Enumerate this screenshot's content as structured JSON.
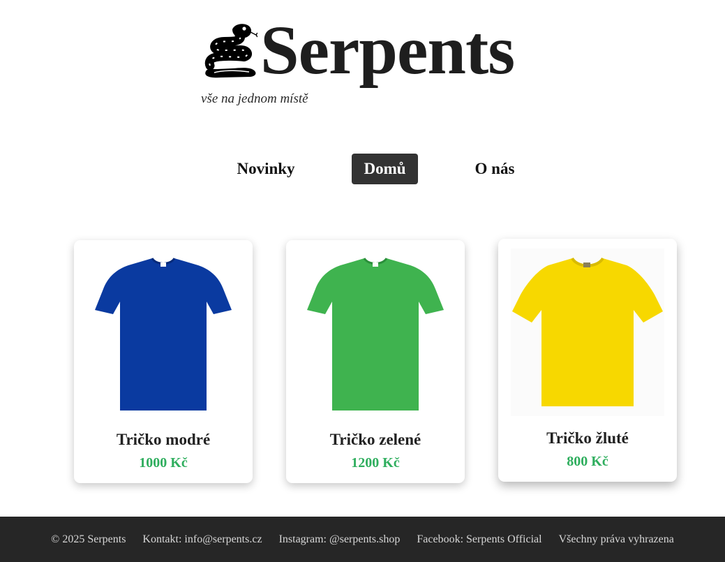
{
  "header": {
    "brand": "Serpents",
    "tagline": "vše na jednom místě",
    "logo_icon": "snake-icon"
  },
  "nav": {
    "items": [
      {
        "label": "Novinky",
        "active": false
      },
      {
        "label": "Domů",
        "active": true
      },
      {
        "label": "O nás",
        "active": false
      }
    ],
    "active_color": "#333333"
  },
  "products": [
    {
      "name": "Tričko modré",
      "price": "1000 Kč",
      "color": "#0a3aa0",
      "image": "blue-tshirt"
    },
    {
      "name": "Tričko zelené",
      "price": "1200 Kč",
      "color": "#3fb34f",
      "image": "green-tshirt"
    },
    {
      "name": "Tričko žluté",
      "price": "800 Kč",
      "color": "#f7d800",
      "image": "yellow-tshirt"
    }
  ],
  "price_color": "#2fae5e",
  "footer": {
    "copyright": "© 2025 Serpents",
    "contact": "Kontakt: info@serpents.cz",
    "instagram": "Instagram: @serpents.shop",
    "facebook": "Facebook: Serpents Official",
    "rights": "Všechny práva vyhrazena",
    "background": "#262626"
  }
}
